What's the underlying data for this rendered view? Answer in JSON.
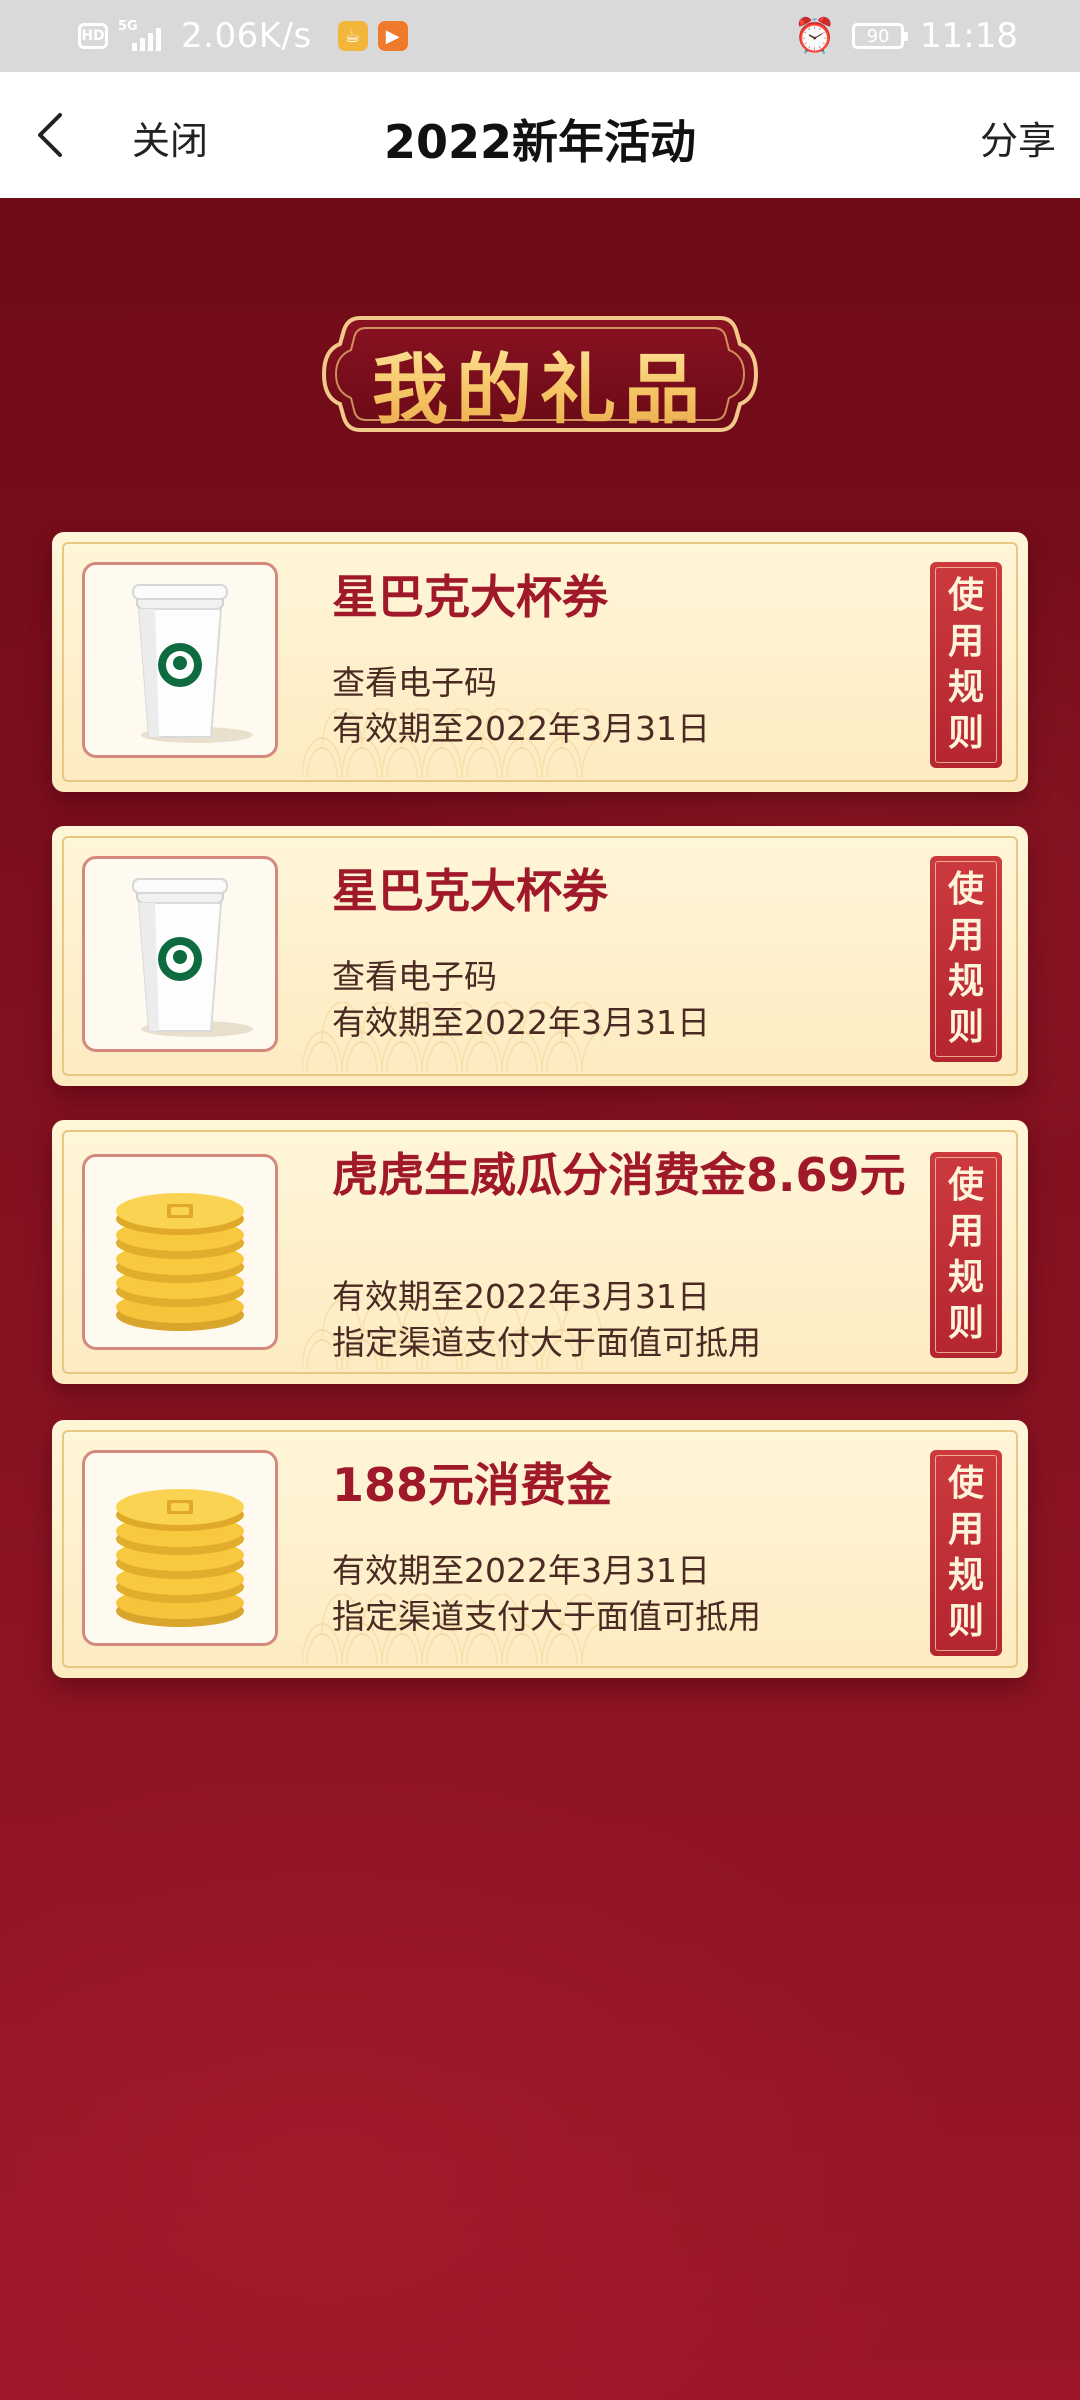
{
  "status_bar": {
    "hd": "HD",
    "network": "5G",
    "speed": "2.06K/s",
    "battery": "90",
    "time": "11:18"
  },
  "nav": {
    "close_label": "关闭",
    "title": "2022新年活动",
    "share_label": "分享"
  },
  "heading": "我的礼品",
  "gifts": [
    {
      "icon": "starbucks-cup-icon",
      "title": "星巴克大杯券",
      "line1": "查看电子码",
      "line2": "有效期至2022年3月31日",
      "rule_label": "使用规则"
    },
    {
      "icon": "starbucks-cup-icon",
      "title": "星巴克大杯券",
      "line1": "查看电子码",
      "line2": "有效期至2022年3月31日",
      "rule_label": "使用规则"
    },
    {
      "icon": "gold-coins-icon",
      "title": "虎虎生威瓜分消费金8.69元",
      "line1": "有效期至2022年3月31日",
      "line2": "指定渠道支付大于面值可抵用",
      "rule_label": "使用规则"
    },
    {
      "icon": "gold-coins-icon",
      "title": "188元消费金",
      "line1": "有效期至2022年3月31日",
      "line2": "指定渠道支付大于面值可抵用",
      "rule_label": "使用规则"
    }
  ],
  "colors": {
    "background": "#7a0f1c",
    "card": "#fdebc0",
    "title_red": "#a0192b",
    "rule_button": "#c0303a"
  }
}
